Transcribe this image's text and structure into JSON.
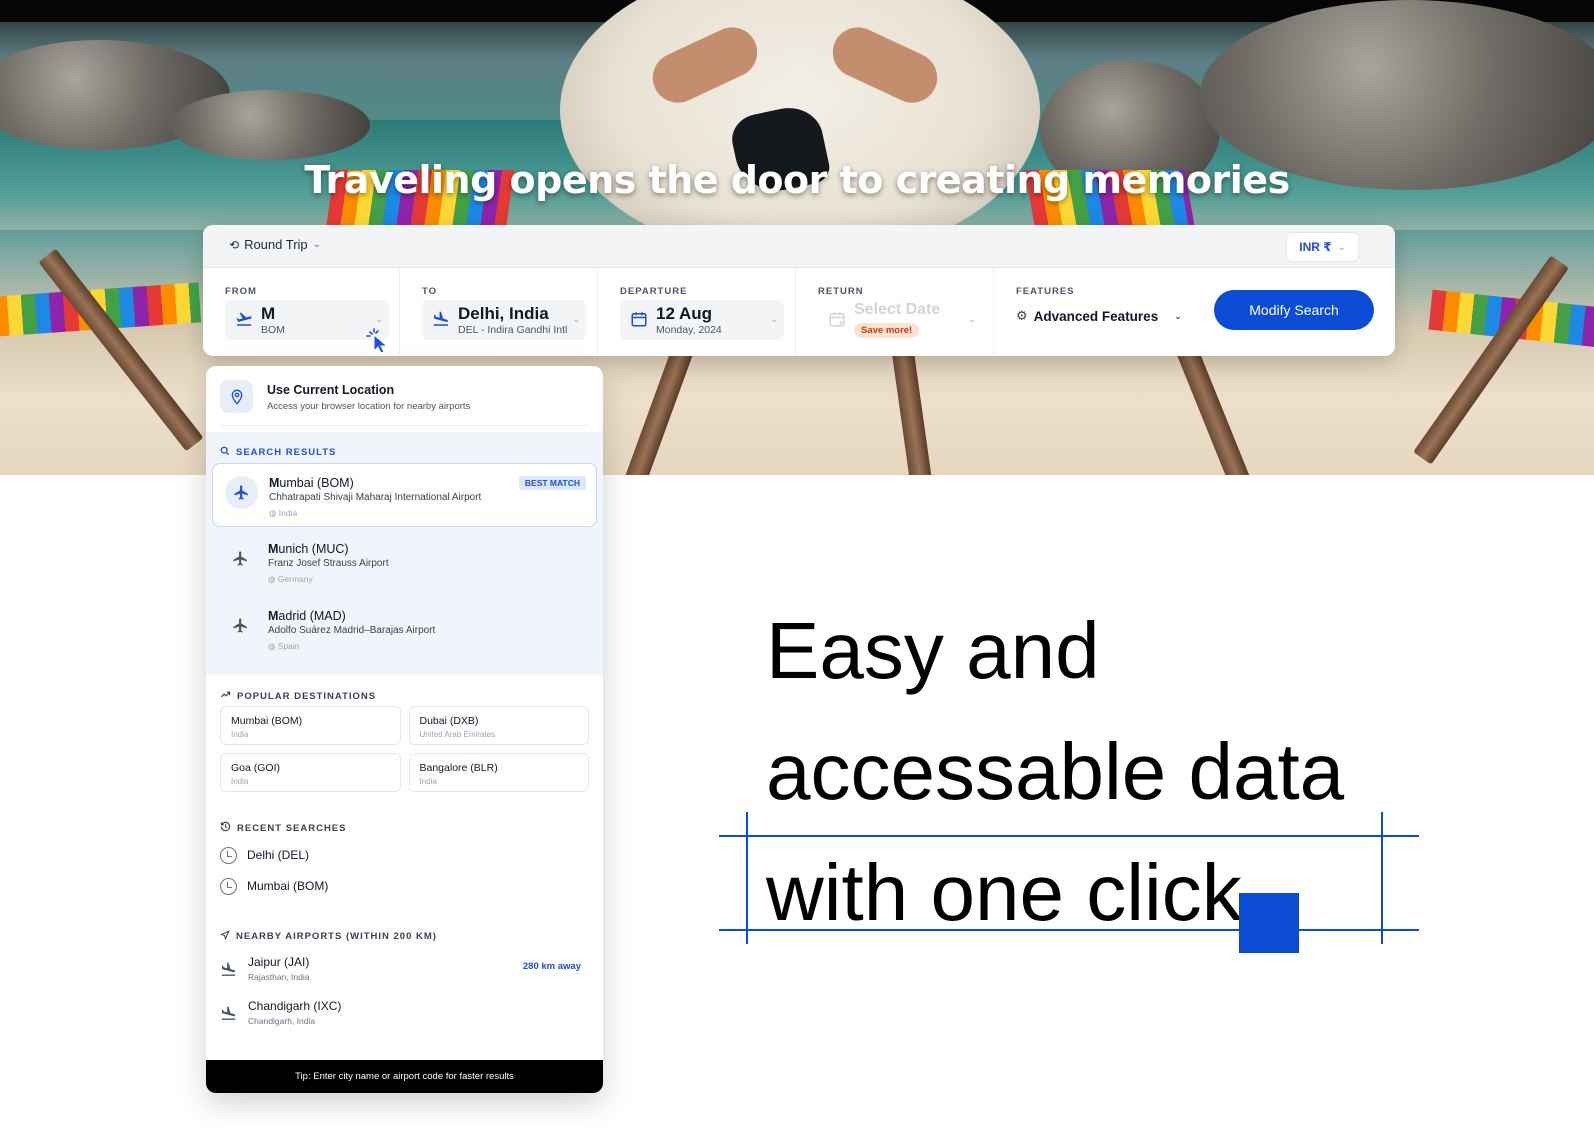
{
  "hero": {
    "title": "Traveling opens the door to creating memories"
  },
  "search": {
    "trip_type": "Round Trip",
    "currency": "INR ₹",
    "from": {
      "label": "FROM",
      "value": "M",
      "code": "BOM"
    },
    "to": {
      "label": "TO",
      "value": "Delhi, India",
      "detail": "DEL - Indira Gandhi Intl"
    },
    "departure": {
      "label": "DEPARTURE",
      "value": "12 Aug",
      "detail": "Monday, 2024"
    },
    "return": {
      "label": "RETURN",
      "placeholder": "Select Date",
      "badge": "Save more!"
    },
    "features": {
      "label": "FEATURES",
      "value": "Advanced Features"
    },
    "modify_label": "Modify Search"
  },
  "dropdown": {
    "current_location": {
      "title": "Use Current Location",
      "subtitle": "Access your browser location for nearby airports"
    },
    "search_results_title": "SEARCH RESULTS",
    "results": [
      {
        "match": "M",
        "rest": "umbai (BOM)",
        "airport": "Chhatrapati Shivaji Maharaj International Airport",
        "country": "India",
        "badge": "BEST MATCH"
      },
      {
        "match": "M",
        "rest": "unich (MUC)",
        "airport": "Franz Josef Strauss Airport",
        "country": "Germany"
      },
      {
        "match": "M",
        "rest": "adrid (MAD)",
        "airport": "Adolfo Suárez Madrid–Barajas Airport",
        "country": "Spain"
      }
    ],
    "popular_title": "POPULAR DESTINATIONS",
    "popular": [
      {
        "name": "Mumbai (BOM)",
        "country": "India"
      },
      {
        "name": "Dubai (DXB)",
        "country": "United Arab Emirates"
      },
      {
        "name": "Goa (GOI)",
        "country": "India"
      },
      {
        "name": "Bangalore (BLR)",
        "country": "India"
      }
    ],
    "recent_title": "RECENT SEARCHES",
    "recent": [
      "Delhi (DEL)",
      "Mumbai (BOM)"
    ],
    "nearby_title": "NEARBY AIRPORTS (WITHIN 200 KM)",
    "nearby": [
      {
        "name": "Jaipur (JAI)",
        "location": "Rajasthan, India",
        "distance": "280 km away"
      },
      {
        "name": "Chandigarh (IXC)",
        "location": "Chandigarh, India"
      }
    ],
    "tip": "Tip: Enter city name or airport code for faster results"
  },
  "headline": {
    "line1": "Easy and",
    "line2": "accessable data",
    "line3": "with one click"
  },
  "colors": {
    "accent": "#0b4bd6",
    "link": "#1d4ed8"
  },
  "icons": {
    "trip": "swap-icon",
    "departure": "plane-takeoff-icon",
    "arrival": "plane-landing-icon",
    "calendar": "calendar-icon",
    "gear": "gear-icon",
    "pin": "location-pin-icon",
    "clock": "clock-icon",
    "cursor": "pointer-cursor-icon"
  }
}
